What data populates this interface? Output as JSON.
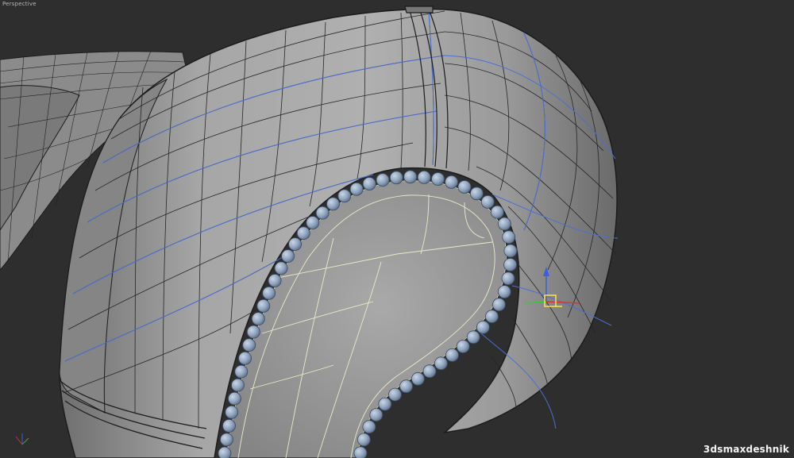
{
  "viewport": {
    "label": "Perspective"
  },
  "watermark": {
    "text": "3dsmaxdeshnik"
  },
  "colors": {
    "background": "#2e2e2e",
    "mesh_fill": "#9a9a9a",
    "wire": "#1c1c1c",
    "selection_edges": "#4a6fd6",
    "inner_edges": "#e8ecc8",
    "buttons": "#8ea3bd"
  },
  "icons": [
    "transform-gizmo-icon"
  ]
}
